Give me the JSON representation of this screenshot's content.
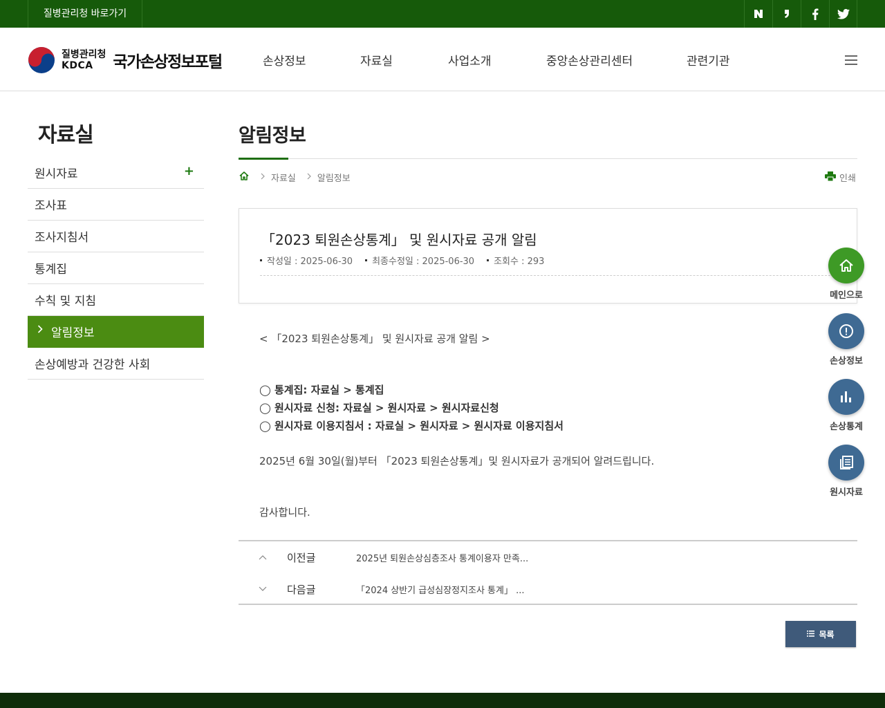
{
  "topbar": {
    "kdca_link": "질병관리청 바로가기",
    "sns": [
      {
        "icon": "naver-blog-icon",
        "glyph": "N"
      },
      {
        "icon": "naver-post-icon",
        "glyph": "❜"
      },
      {
        "icon": "facebook-icon",
        "glyph": "f"
      },
      {
        "icon": "twitter-icon",
        "glyph": "t"
      }
    ]
  },
  "header": {
    "org_ko": "질병관리청",
    "org_en": "KDCA",
    "portal": "국가손상정보포털",
    "gnb": [
      "손상정보",
      "자료실",
      "사업소개",
      "중앙손상관리센터",
      "관련기관"
    ]
  },
  "sidebar": {
    "title": "자료실",
    "items": [
      {
        "label": "원시자료",
        "has_sub": true
      },
      {
        "label": "조사표"
      },
      {
        "label": "조사지침서"
      },
      {
        "label": "통계집"
      },
      {
        "label": "수칙 및 지침"
      },
      {
        "label": "알림정보",
        "active": true
      },
      {
        "label": "손상예방과 건강한 사회"
      }
    ]
  },
  "content": {
    "page_title": "알림정보",
    "breadcrumb": [
      "자료실",
      "알림정보"
    ],
    "print_label": "인쇄",
    "post": {
      "title": "「2023 퇴원손상통계」 및 원시자료 공개 알림",
      "meta": {
        "created": "작성일 : 2025-06-30",
        "modified": "최종수정일 : 2025-06-30",
        "views": "조회수 : 293"
      }
    },
    "body": {
      "intro": "< 「2023 퇴원손상통계」 및 원시자료 공개 알림 >",
      "bold_lines": [
        "◯ 통계집: 자료실 > 통계집",
        "◯ 원시자료 신청: 자료실 > 원시자료 > 원시자료신청",
        "◯ 원시자료 이용지침서 : 자료실 > 원시자료 > 원시자료 이용지침서"
      ],
      "notice": "2025년 6월 30일(월)부터 「2023 퇴원손상통계」및 원시자료가 공개되어 알려드립니다.",
      "thanks": "감사합니다."
    },
    "nav": {
      "prev_label": "이전글",
      "prev_title": "2025년 퇴원손상심층조사 통계이용자 만족...",
      "next_label": "다음글",
      "next_title": "「2024 상반기 급성심장정지조사 통계」 ..."
    },
    "list_button": "목록"
  },
  "quick_menu": [
    {
      "label": "메인으로",
      "icon": "home-icon",
      "color": "#3e9a26"
    },
    {
      "label": "손상정보",
      "icon": "alert-circle-icon",
      "color": "#3f6a93"
    },
    {
      "label": "손상통계",
      "icon": "bar-chart-icon",
      "color": "#3f6a93"
    },
    {
      "label": "원시자료",
      "icon": "document-list-icon",
      "color": "#3f6a93"
    }
  ]
}
